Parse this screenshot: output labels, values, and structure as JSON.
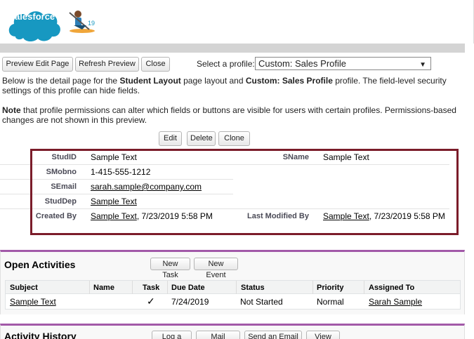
{
  "branding": {
    "logo_text": "salesforce",
    "release": "19"
  },
  "toolbar": {
    "preview_edit": "Preview Edit Page",
    "refresh": "Refresh Preview",
    "close": "Close",
    "profile_label": "Select a profile:",
    "profile_value": "Custom: Sales Profile"
  },
  "info": {
    "p1_a": "Below is the detail page for the ",
    "p1_layout": "Student Layout",
    "p1_b": " page layout and ",
    "p1_profile": "Custom: Sales Profile",
    "p1_c": " profile. The field-level security",
    "p1_d": "settings of this profile can hide fields.",
    "p2_note": "Note",
    "p2_a": " that profile permissions can alter which fields or buttons are visible for users with certain profiles. Permissions-based",
    "p2_b": "changes are not shown in this preview."
  },
  "detail_buttons": {
    "edit": "Edit",
    "delete": "Delete",
    "clone": "Clone"
  },
  "fields": {
    "studid_label": "StudID",
    "studid_value": "Sample Text",
    "sname_label": "SName",
    "sname_value": "Sample Text",
    "smobno_label": "SMobno",
    "smobno_value": "1-415-555-1212",
    "semail_label": "SEmail",
    "semail_value": "sarah.sample@company.com",
    "studdep_label": "StudDep",
    "studdep_value": "Sample Text",
    "createdby_label": "Created By",
    "createdby_user": "Sample Text",
    "createdby_date": ", 7/23/2019 5:58 PM",
    "modifiedby_label": "Last Modified By",
    "modifiedby_user": "Sample Text",
    "modifiedby_date": ", 7/23/2019 5:58 PM"
  },
  "open_activities": {
    "title": "Open Activities",
    "new_task": "New Task",
    "new_event": "New Event",
    "columns": [
      "Subject",
      "Name",
      "Task",
      "Due Date",
      "Status",
      "Priority",
      "Assigned To"
    ],
    "row": {
      "subject": "Sample Text",
      "name": "",
      "task": "✓",
      "due": "7/24/2019",
      "status": "Not Started",
      "priority": "Normal",
      "assigned": "Sarah Sample"
    }
  },
  "activity_history": {
    "title": "Activity History",
    "log_call": "Log a Call",
    "mail_merge": "Mail Merge",
    "send_email": "Send an Email",
    "view_all": "View All"
  },
  "colors": {
    "box_border": "#7b1c2a",
    "section_accent": "#a259a8",
    "brand_blue": "#1798c1"
  }
}
